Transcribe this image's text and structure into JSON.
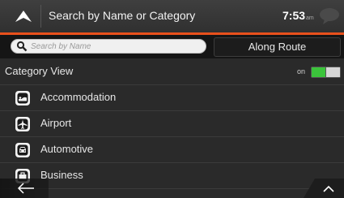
{
  "header": {
    "title": "Search by Name or Category",
    "time": "7:53",
    "time_suffix": "am",
    "up_icon": "triangle-up-icon",
    "message_icon": "speech-bubble-icon"
  },
  "search": {
    "placeholder": "Search by Name",
    "value": "",
    "along_route_label": "Along Route"
  },
  "category_view": {
    "label": "Category View",
    "toggle_text": "on",
    "toggle_on": true
  },
  "categories": [
    {
      "label": "Accommodation",
      "icon": "bed-icon"
    },
    {
      "label": "Airport",
      "icon": "airplane-icon"
    },
    {
      "label": "Automotive",
      "icon": "car-icon"
    },
    {
      "label": "Business",
      "icon": "briefcase-icon"
    }
  ],
  "nav": {
    "back_icon": "arrow-left-icon",
    "scroll_up_icon": "chevron-up-icon"
  },
  "colors": {
    "accent": "#e8501c",
    "toggle_on": "#3bc43b",
    "background": "#2a2a2a"
  }
}
